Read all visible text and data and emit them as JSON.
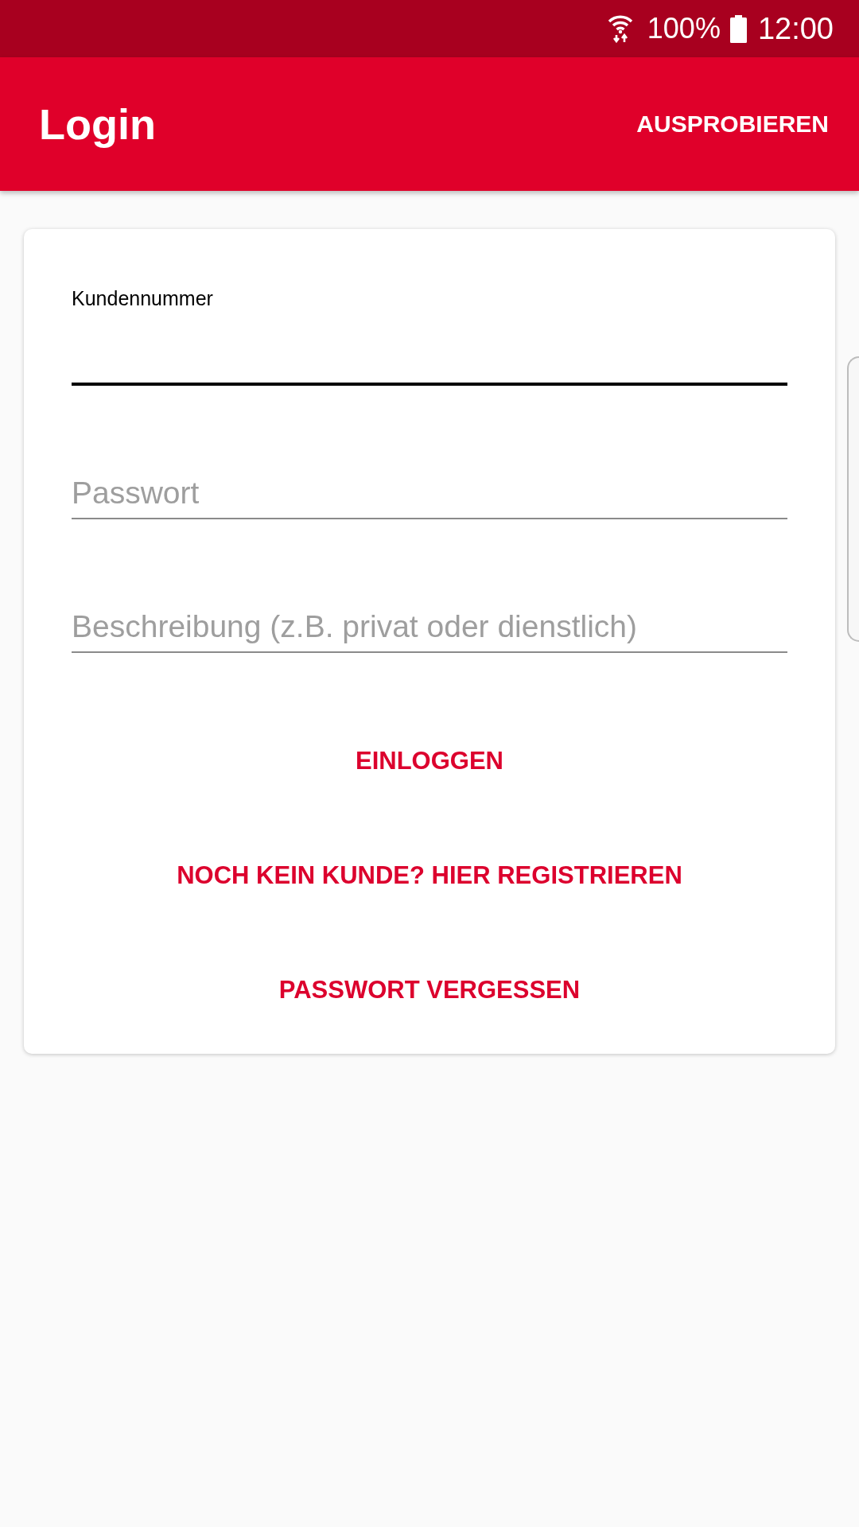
{
  "status_bar": {
    "battery_text": "100%",
    "time": "12:00"
  },
  "app_bar": {
    "title": "Login",
    "action": "AUSPROBIEREN"
  },
  "form": {
    "fields": [
      {
        "label": "Kundennummer",
        "focused": true
      },
      {
        "placeholder": "Passwort",
        "focused": false
      },
      {
        "placeholder": "Beschreibung (z.B. privat oder dienstlich)",
        "focused": false
      }
    ],
    "buttons": [
      "EINLOGGEN",
      "NOCH KEIN KUNDE? HIER REGISTRIEREN",
      "PASSWORT VERGESSEN"
    ]
  }
}
